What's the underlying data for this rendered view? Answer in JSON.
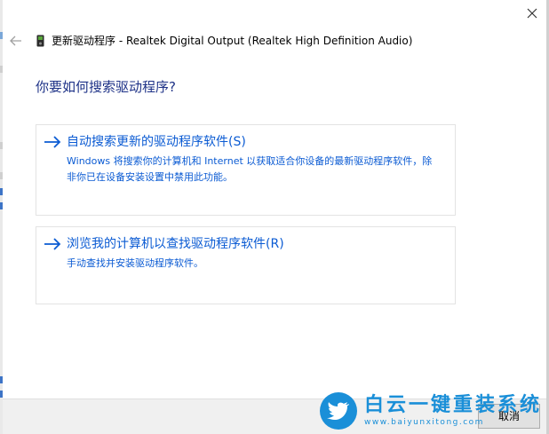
{
  "dialog": {
    "title": "更新驱动程序 - Realtek Digital Output (Realtek High Definition Audio)",
    "heading": "你要如何搜索驱动程序?"
  },
  "options": [
    {
      "title": "自动搜索更新的驱动程序软件(S)",
      "description": "Windows 将搜索你的计算机和 Internet 以获取适合你设备的最新驱动程序软件，除非你已在设备安装设置中禁用此功能。"
    },
    {
      "title": "浏览我的计算机以查找驱动程序软件(R)",
      "description": "手动查找并安装驱动程序软件。"
    }
  ],
  "footer": {
    "cancel_label": "取消"
  },
  "watermark": {
    "brand": "白云一键重装系统",
    "url": "www.baiyunxitong.com"
  },
  "icons": {
    "close": "close-icon",
    "back": "back-arrow-icon",
    "device": "audio-device-icon",
    "option_arrow": "right-arrow-icon",
    "watermark": "bird-logo-icon"
  },
  "colors": {
    "heading": "#1e3287",
    "link": "#0b5bd3",
    "footer_bg": "#f0f0f0",
    "watermark": "#1a8fd8"
  }
}
